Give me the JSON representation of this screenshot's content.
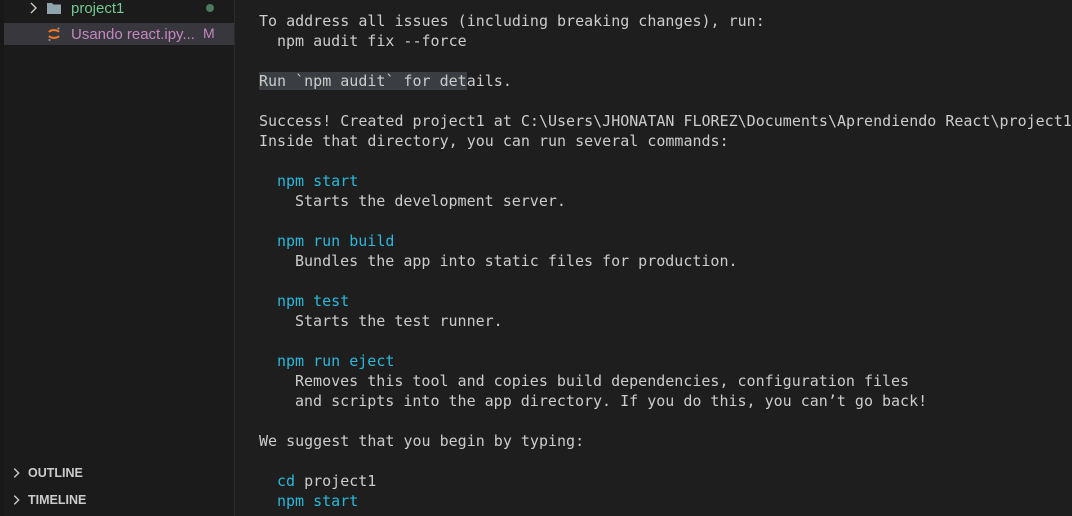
{
  "sidebar": {
    "folder": {
      "label": "project1",
      "icon": "folder-icon",
      "status": "modified-dot"
    },
    "file": {
      "label": "Usando react.ipy...",
      "badge": "M",
      "icon": "jupyter-icon"
    },
    "sections": [
      {
        "label": "OUTLINE"
      },
      {
        "label": "TIMELINE"
      }
    ]
  },
  "terminal": {
    "lines": {
      "fix_all": "To address all issues (including breaking changes), run:",
      "fix_cmd": "npm audit fix --force",
      "audit_details_hl": "Run `npm audit` for det",
      "audit_details_rest": "ails.",
      "success": "Success! Created project1 at C:\\Users\\JHONATAN FLOREZ\\Documents\\Aprendiendo React\\project1",
      "inside": "Inside that directory, you can run several commands:",
      "cmd_start": "npm start",
      "desc_start": "Starts the development server.",
      "cmd_build": "npm run build",
      "desc_build": "Bundles the app into static files for production.",
      "cmd_test": "npm test",
      "desc_test": "Starts the test runner.",
      "cmd_eject": "npm run eject",
      "desc_eject_1": "Removes this tool and copies build dependencies, configuration files",
      "desc_eject_2": "and scripts into the app directory. If you do this, you can’t go back!",
      "suggest": "We suggest that you begin by typing:",
      "cd_cmd": "cd",
      "cd_arg": "project1",
      "final_start": "npm start"
    }
  },
  "colors": {
    "command": "#29b8db",
    "text": "#cccccc",
    "folder_label": "#73c991",
    "modified_file": "#c586c0"
  }
}
